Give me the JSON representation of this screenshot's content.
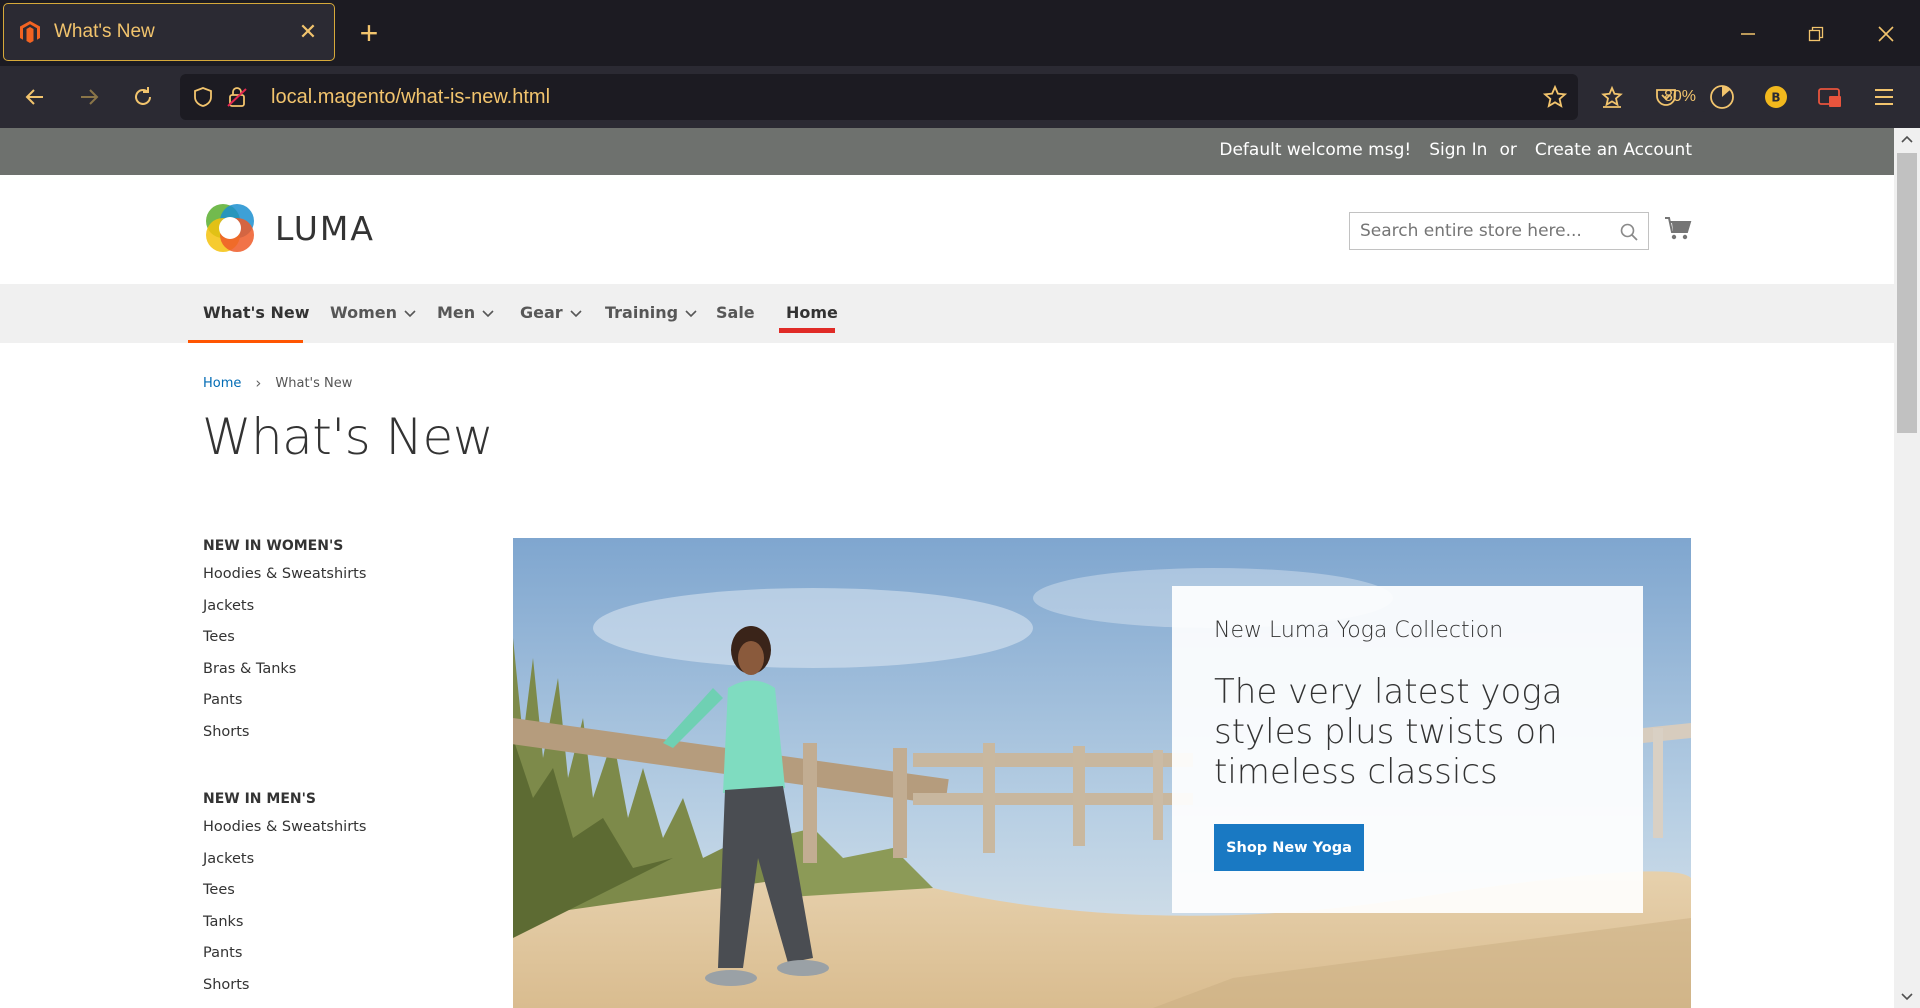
{
  "browser": {
    "tab_title": "What's New",
    "url": "local.magento/what-is-new.html",
    "zoom": "80%",
    "accent_color": "#f2c46d"
  },
  "panel": {
    "welcome": "Default welcome msg!",
    "sign_in": "Sign In",
    "or": "or",
    "create_account": "Create an Account"
  },
  "header": {
    "logo_text": "LUMA",
    "search_placeholder": "Search entire store here..."
  },
  "nav": {
    "items": [
      {
        "label": "What's New",
        "has_dropdown": false,
        "active": true
      },
      {
        "label": "Women",
        "has_dropdown": true
      },
      {
        "label": "Men",
        "has_dropdown": true
      },
      {
        "label": "Gear",
        "has_dropdown": true
      },
      {
        "label": "Training",
        "has_dropdown": true
      },
      {
        "label": "Sale",
        "has_dropdown": false
      },
      {
        "label": "Home",
        "has_dropdown": false
      }
    ]
  },
  "breadcrumb": {
    "home": "Home",
    "current": "What's New"
  },
  "page_title": "What's New",
  "sidebar": {
    "women": {
      "heading": "NEW IN WOMEN'S",
      "items": [
        "Hoodies & Sweatshirts",
        "Jackets",
        "Tees",
        "Bras & Tanks",
        "Pants",
        "Shorts"
      ]
    },
    "men": {
      "heading": "NEW IN MEN'S",
      "items": [
        "Hoodies & Sweatshirts",
        "Jackets",
        "Tees",
        "Tanks",
        "Pants",
        "Shorts"
      ]
    }
  },
  "hero": {
    "subtitle": "New Luma Yoga Collection",
    "headline": "The very latest yoga styles plus twists on timeless classics",
    "button": "Shop New Yoga"
  }
}
